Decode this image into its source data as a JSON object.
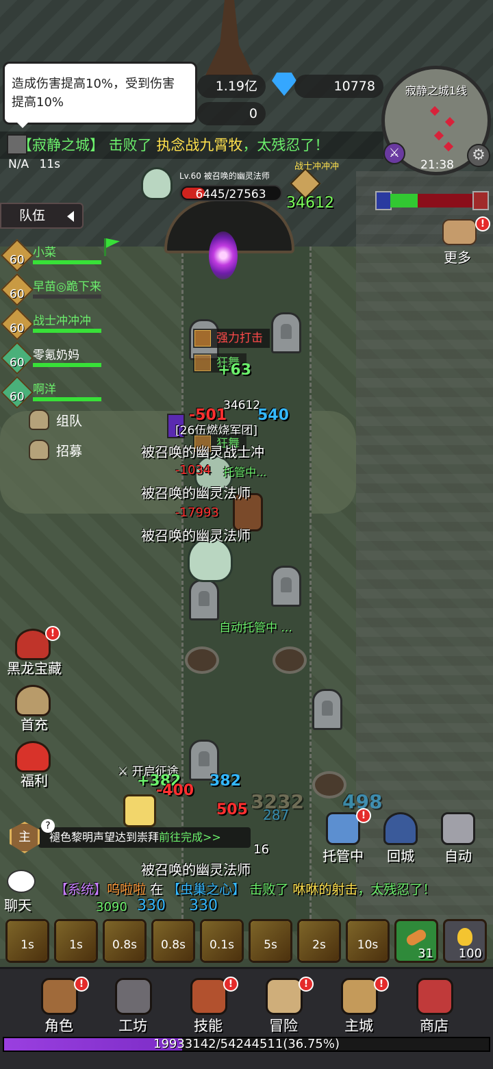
{
  "colors": {
    "heal": "#6cf06c",
    "damage": "#ff3030",
    "crit": "#ffd84a",
    "mana": "#34b8ff",
    "hp_bar": "#d0231e",
    "ally_bar": "#38e038",
    "xp_bar": "#9a3fe0"
  },
  "tooltip": {
    "text_line1": "造成伤害提高10%，受到伤害",
    "text_line2": "提高10%"
  },
  "resources": {
    "gold": "1.19亿",
    "gems": "10778",
    "secondary": "0",
    "gem_icon": "blue-crystal-icon"
  },
  "kill_banner": {
    "map_name": "【寂静之城】",
    "verb": "击败了",
    "victim": "执念战九霄牧",
    "suffix": "，太残忍了！"
  },
  "buff_timer": {
    "label": "N/A",
    "time": "11s"
  },
  "minimap": {
    "title": "寂静之城1线",
    "clock": "21:38",
    "gear_icon": "gear-icon",
    "swords_icon": "crossed-swords-icon"
  },
  "boss": {
    "name": "Lv.60 被召唤的幽灵法师",
    "hp_text": "6445/27563",
    "hp_fraction": 0.234
  },
  "team_power": {
    "name": "战士冲冲冲",
    "power": "34612"
  },
  "pvp": {
    "ally_fraction": 0.33
  },
  "team_panel": {
    "tab_label": "队伍",
    "members": [
      {
        "level": "60",
        "name": "小菜",
        "name_color": "#6cf06c",
        "hp": 1.0
      },
      {
        "level": "60",
        "name": "早苗◎跪下来",
        "name_color": "#6cf06c",
        "hp": 1.0
      },
      {
        "level": "60",
        "name": "战士冲冲冲",
        "name_color": "#6cf06c",
        "hp": 1.0
      },
      {
        "level": "60",
        "name": "零氪奶妈",
        "name_color": "#ffffff",
        "hp": 1.0
      },
      {
        "level": "60",
        "name": "啊洋",
        "name_color": "#6cf06c",
        "hp": 1.0
      }
    ],
    "form_team": "组队",
    "recruit": "招募"
  },
  "more_button": {
    "label": "更多"
  },
  "combat": {
    "skill_tag_1": "强力打击",
    "skill_tag_2": "狂舞",
    "skill_tag_3": "狂舞",
    "guild_tag": "[26伍燃烧军团]",
    "heal_1": "+63",
    "ally_power": "34612",
    "dmg_1": "-501",
    "dmg_1b": "540",
    "ally_name": "被召唤的幽灵战士冲",
    "dmg_2": "-1034",
    "status_1": "托管中...",
    "enemy_name_1": "被召唤的幽灵法师",
    "dmg_3": "-17993",
    "enemy_name_2": "被召唤的幽灵法师",
    "auto_status": "自动托管中 ...",
    "expedition": "开启征途",
    "heal_2": "+382",
    "mana_2": "382",
    "dmg_4": "-400",
    "dmg_5": "3232",
    "mana_5": "498",
    "dmg_6": "505",
    "mana_6": "287",
    "dmg_7": "16",
    "enemy_name_3": "被召唤的幽灵法师",
    "heal_3": "3090",
    "mana_3": "330",
    "mana_4": "330"
  },
  "left_buttons": [
    {
      "label": "黑龙宝藏",
      "icon": "black-dragon-icon",
      "color": "#c0342a",
      "badge": "!"
    },
    {
      "label": "首充",
      "icon": "first-recharge-icon",
      "color": "#b89b6a",
      "badge": ""
    },
    {
      "label": "福利",
      "icon": "gift-box-icon",
      "color": "#d8332a",
      "badge": ""
    }
  ],
  "right_buttons": [
    {
      "label": "托管中",
      "icon": "auto-manage-icon",
      "color": "#5c8fd0",
      "badge": "!"
    },
    {
      "label": "回城",
      "icon": "return-portal-icon",
      "color": "#3a5a9a",
      "badge": ""
    },
    {
      "label": "自动",
      "icon": "crossed-swords-icon",
      "color": "#a0a0a8",
      "badge": ""
    }
  ],
  "quest": {
    "badge": "主",
    "text": "褪色黎明声望达到崇拜",
    "link": "前往完成>>"
  },
  "chat": {
    "label": "聊天",
    "icon": "chat-bubble-icon"
  },
  "system_message": {
    "tag": "【系统】",
    "player": "呜啦啦",
    "in": "在",
    "map": "【虫巢之心】",
    "verb": "击败了",
    "victim": "咻咻的射击",
    "suffix": "，太残忍了！"
  },
  "skills": [
    {
      "cd": "1s",
      "icon": "warrior-rage-icon"
    },
    {
      "cd": "1s",
      "icon": "sword-slash-icon"
    },
    {
      "cd": "0.8s",
      "icon": "whirlwind-icon"
    },
    {
      "cd": "0.8s",
      "icon": "cleave-icon"
    },
    {
      "cd": "0.1s",
      "icon": "strike-icon"
    },
    {
      "cd": "5s",
      "icon": "berserk-icon"
    },
    {
      "cd": "2s",
      "icon": "charge-icon"
    },
    {
      "cd": "10s",
      "icon": "skull-icon"
    }
  ],
  "potions": [
    {
      "count": "31",
      "icon": "bread-icon",
      "color": "#2f8a3a"
    },
    {
      "count": "100",
      "icon": "potion-icon",
      "color": "#4a4a52"
    }
  ],
  "bottom_nav": [
    {
      "label": "角色",
      "icon": "character-icon",
      "color": "#a06a3a"
    },
    {
      "label": "工坊",
      "icon": "anvil-icon",
      "color": "#6d6a70"
    },
    {
      "label": "技能",
      "icon": "skill-book-icon",
      "color": "#b2512e"
    },
    {
      "label": "冒险",
      "icon": "map-scroll-icon",
      "color": "#cfae7a"
    },
    {
      "label": "主城",
      "icon": "castle-icon",
      "color": "#c49a5a"
    },
    {
      "label": "商店",
      "icon": "shop-icon",
      "color": "#c03a3a"
    }
  ],
  "xp": {
    "text": "19933142/54244511(36.75%)",
    "fraction": 0.3675
  }
}
